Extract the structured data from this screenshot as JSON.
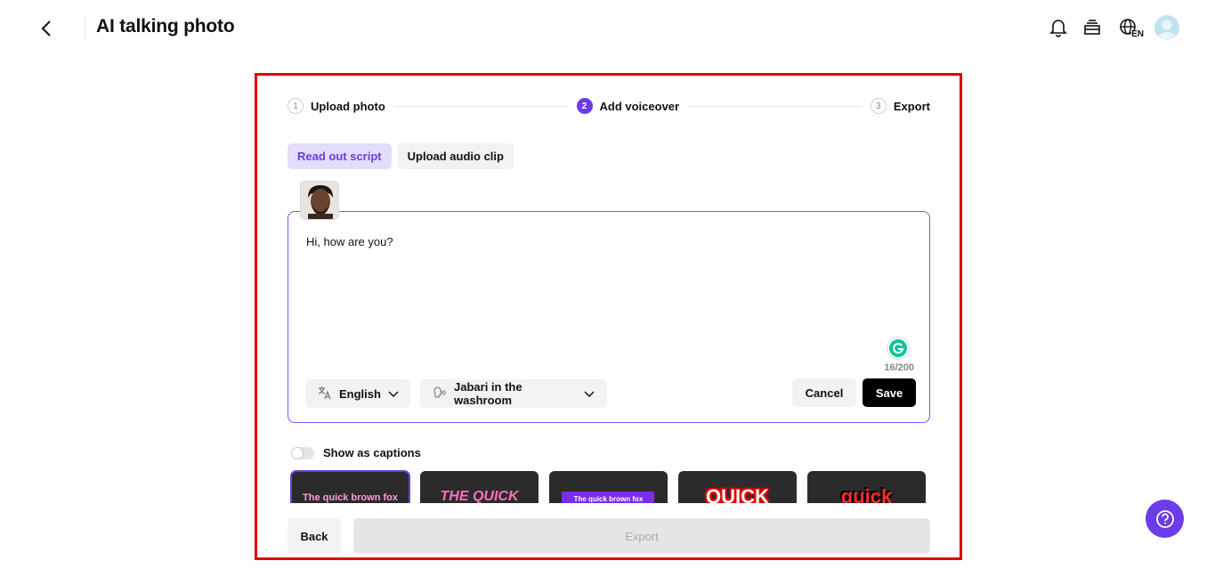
{
  "header": {
    "title": "AI talking photo",
    "language_badge": "EN",
    "icons": [
      "back-arrow-icon",
      "bell-icon",
      "stack-icon",
      "globe-icon",
      "avatar"
    ]
  },
  "stepper": {
    "steps": [
      {
        "num": "1",
        "label": "Upload photo",
        "state": "done"
      },
      {
        "num": "2",
        "label": "Add voiceover",
        "state": "active"
      },
      {
        "num": "3",
        "label": "Export",
        "state": "pending"
      }
    ]
  },
  "tabs": [
    {
      "label": "Read out script",
      "active": true
    },
    {
      "label": "Upload audio clip",
      "active": false
    }
  ],
  "script": {
    "text": "Hi, how are you?",
    "char_count": "16/200"
  },
  "controls": {
    "language": "English",
    "voice": "Jabari in the washroom",
    "cancel_label": "Cancel",
    "save_label": "Save"
  },
  "captions": {
    "toggle_label": "Show as captions",
    "enabled": false,
    "styles": [
      {
        "preview": "The quick brown fox"
      },
      {
        "preview": "THE QUICK"
      },
      {
        "preview": "The quick brown fox"
      },
      {
        "preview": "QUICK"
      },
      {
        "preview": "quick"
      }
    ]
  },
  "footer": {
    "back_label": "Back",
    "export_label": "Export"
  },
  "colors": {
    "accent": "#6c3ce8",
    "highlight_border": "#e00000"
  }
}
